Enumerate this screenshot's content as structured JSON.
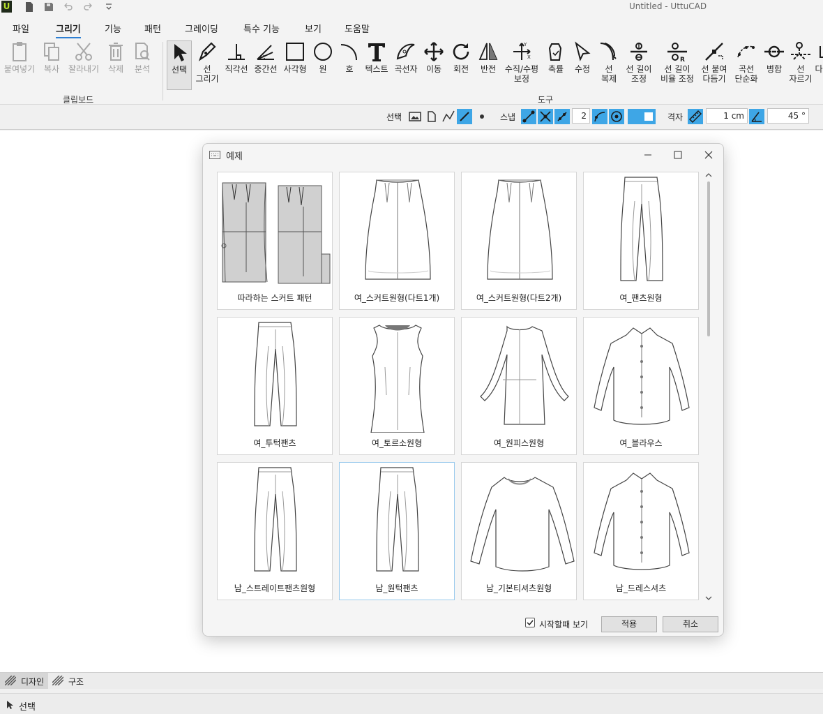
{
  "window": {
    "title": "Untitled - UttuCAD",
    "logo_letter": "U"
  },
  "quick_access": [
    "new-document-icon",
    "save-icon",
    "undo-icon",
    "redo-icon",
    "customize-dropdown-icon"
  ],
  "menu": [
    "파일",
    "그리기",
    "기능",
    "패턴",
    "그레이딩",
    "특수 기능",
    "보기",
    "도움말"
  ],
  "menu_active": "그리기",
  "ribbon": {
    "clipboard_group_label": "클립보드",
    "tools_group_label": "도구",
    "clipboard": [
      {
        "label": "붙여넣기",
        "icon": "paste-icon"
      },
      {
        "label": "복사",
        "icon": "copy-icon"
      },
      {
        "label": "잘라내기",
        "icon": "scissors-icon"
      },
      {
        "label": "삭제",
        "icon": "trash-icon"
      },
      {
        "label": "분석",
        "icon": "analyze-icon"
      }
    ],
    "tools": [
      {
        "line1": "선택",
        "line2": "",
        "icon": "cursor-arrow-icon"
      },
      {
        "line1": "선",
        "line2": "그리기",
        "icon": "pen-icon"
      },
      {
        "line1": "직각선",
        "line2": "",
        "icon": "perpendicular-icon"
      },
      {
        "line1": "중간선",
        "line2": "",
        "icon": "angle-bisector-icon"
      },
      {
        "line1": "사각형",
        "line2": "",
        "icon": "rectangle-icon"
      },
      {
        "line1": "원",
        "line2": "",
        "icon": "circle-icon"
      },
      {
        "line1": "호",
        "line2": "",
        "icon": "arc-icon"
      },
      {
        "line1": "텍스트",
        "line2": "",
        "icon": "text-icon"
      },
      {
        "line1": "곡선자",
        "line2": "",
        "icon": "french-curve-icon"
      },
      {
        "line1": "이동",
        "line2": "",
        "icon": "move-icon"
      },
      {
        "line1": "회전",
        "line2": "",
        "icon": "rotate-icon"
      },
      {
        "line1": "반전",
        "line2": "",
        "icon": "mirror-icon"
      },
      {
        "line1": "수직/수평",
        "line2": "보정",
        "icon": "axis-correct-icon"
      },
      {
        "line1": "축률",
        "line2": "",
        "icon": "shrink-icon"
      },
      {
        "line1": "수정",
        "line2": "",
        "icon": "edit-cursor-icon"
      },
      {
        "line1": "선",
        "line2": "복제",
        "icon": "line-duplicate-icon"
      },
      {
        "line1": "선 길이",
        "line2": "조정",
        "icon": "length-adjust-icon"
      },
      {
        "line1": "선 길이",
        "line2": "비율 조정",
        "icon": "length-ratio-icon"
      },
      {
        "line1": "선 붙여",
        "line2": "다듬기",
        "icon": "line-join-icon"
      },
      {
        "line1": "곡선",
        "line2": "단순화",
        "icon": "curve-simplify-icon"
      },
      {
        "line1": "병합",
        "line2": "",
        "icon": "merge-icon"
      },
      {
        "line1": "선",
        "line2": "자르기",
        "icon": "line-cut-icon"
      },
      {
        "line1": "다",
        "line2": "",
        "icon": "more-icon"
      }
    ]
  },
  "propbar": {
    "select_label": "선택",
    "snap_label": "스냅",
    "snap_value": "2",
    "grid_label": "격자",
    "grid_value": "1 cm",
    "angle_value": "45 °"
  },
  "dialog": {
    "title": "예제",
    "start_checkbox_label": "시작할때 보기",
    "start_checkbox_checked": true,
    "apply_label": "적용",
    "cancel_label": "취소",
    "items": [
      {
        "label": "따라하는 스커트 패턴",
        "art": "pattern"
      },
      {
        "label": "여_스커트원형(다트1개)",
        "art": "skirt"
      },
      {
        "label": "여_스커트원형(다트2개)",
        "art": "skirt"
      },
      {
        "label": "여_팬츠원형",
        "art": "pants"
      },
      {
        "label": "여_투턱팬츠",
        "art": "pants"
      },
      {
        "label": "여_토르소원형",
        "art": "torso"
      },
      {
        "label": "여_원피스원형",
        "art": "dress"
      },
      {
        "label": "여_블라우스",
        "art": "shirt"
      },
      {
        "label": "남_스트레이트팬츠원형",
        "art": "pants"
      },
      {
        "label": "남_원턱팬츠",
        "art": "pants"
      },
      {
        "label": "남_기본티셔츠원형",
        "art": "tshirt"
      },
      {
        "label": "남_드레스셔츠",
        "art": "shirt"
      }
    ]
  },
  "bottom_tabs": [
    "디자인",
    "구조"
  ],
  "status": "선택"
}
